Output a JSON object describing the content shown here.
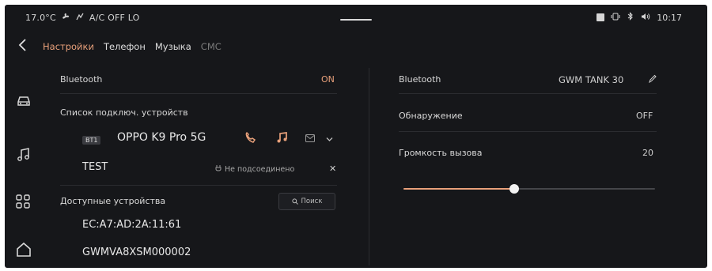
{
  "status": {
    "temperature": "17.0°C",
    "ac_status": "A/C OFF LO",
    "time": "10:17"
  },
  "tabs": [
    {
      "label": "Настройки"
    },
    {
      "label": "Телефон"
    },
    {
      "label": "Музыка"
    },
    {
      "label": "СМС"
    }
  ],
  "left": {
    "bluetooth_label": "Bluetooth",
    "bluetooth_value": "ON",
    "connected_list_label": "Список подключ. устройств",
    "devices": [
      {
        "badge": "BT1",
        "name": "OPPO K9 Pro 5G"
      },
      {
        "name": "TEST",
        "status": "Не подсоединено"
      }
    ],
    "available_label": "Доступные устройства",
    "search_label": "Поиск",
    "available_devices": [
      {
        "name": "EC:A7:AD:2A:11:61"
      },
      {
        "name": "GWMVA8XSM000002"
      }
    ]
  },
  "right": {
    "bluetooth_label": "Bluetooth",
    "bluetooth_name": "GWM TANK 30",
    "discovery_label": "Обнаружение",
    "discovery_value": "OFF",
    "call_volume_label": "Громкость вызова",
    "call_volume_value": "20",
    "call_volume_fraction": 0.44
  },
  "colors": {
    "accent": "#e8a07a",
    "background": "#16171a"
  }
}
